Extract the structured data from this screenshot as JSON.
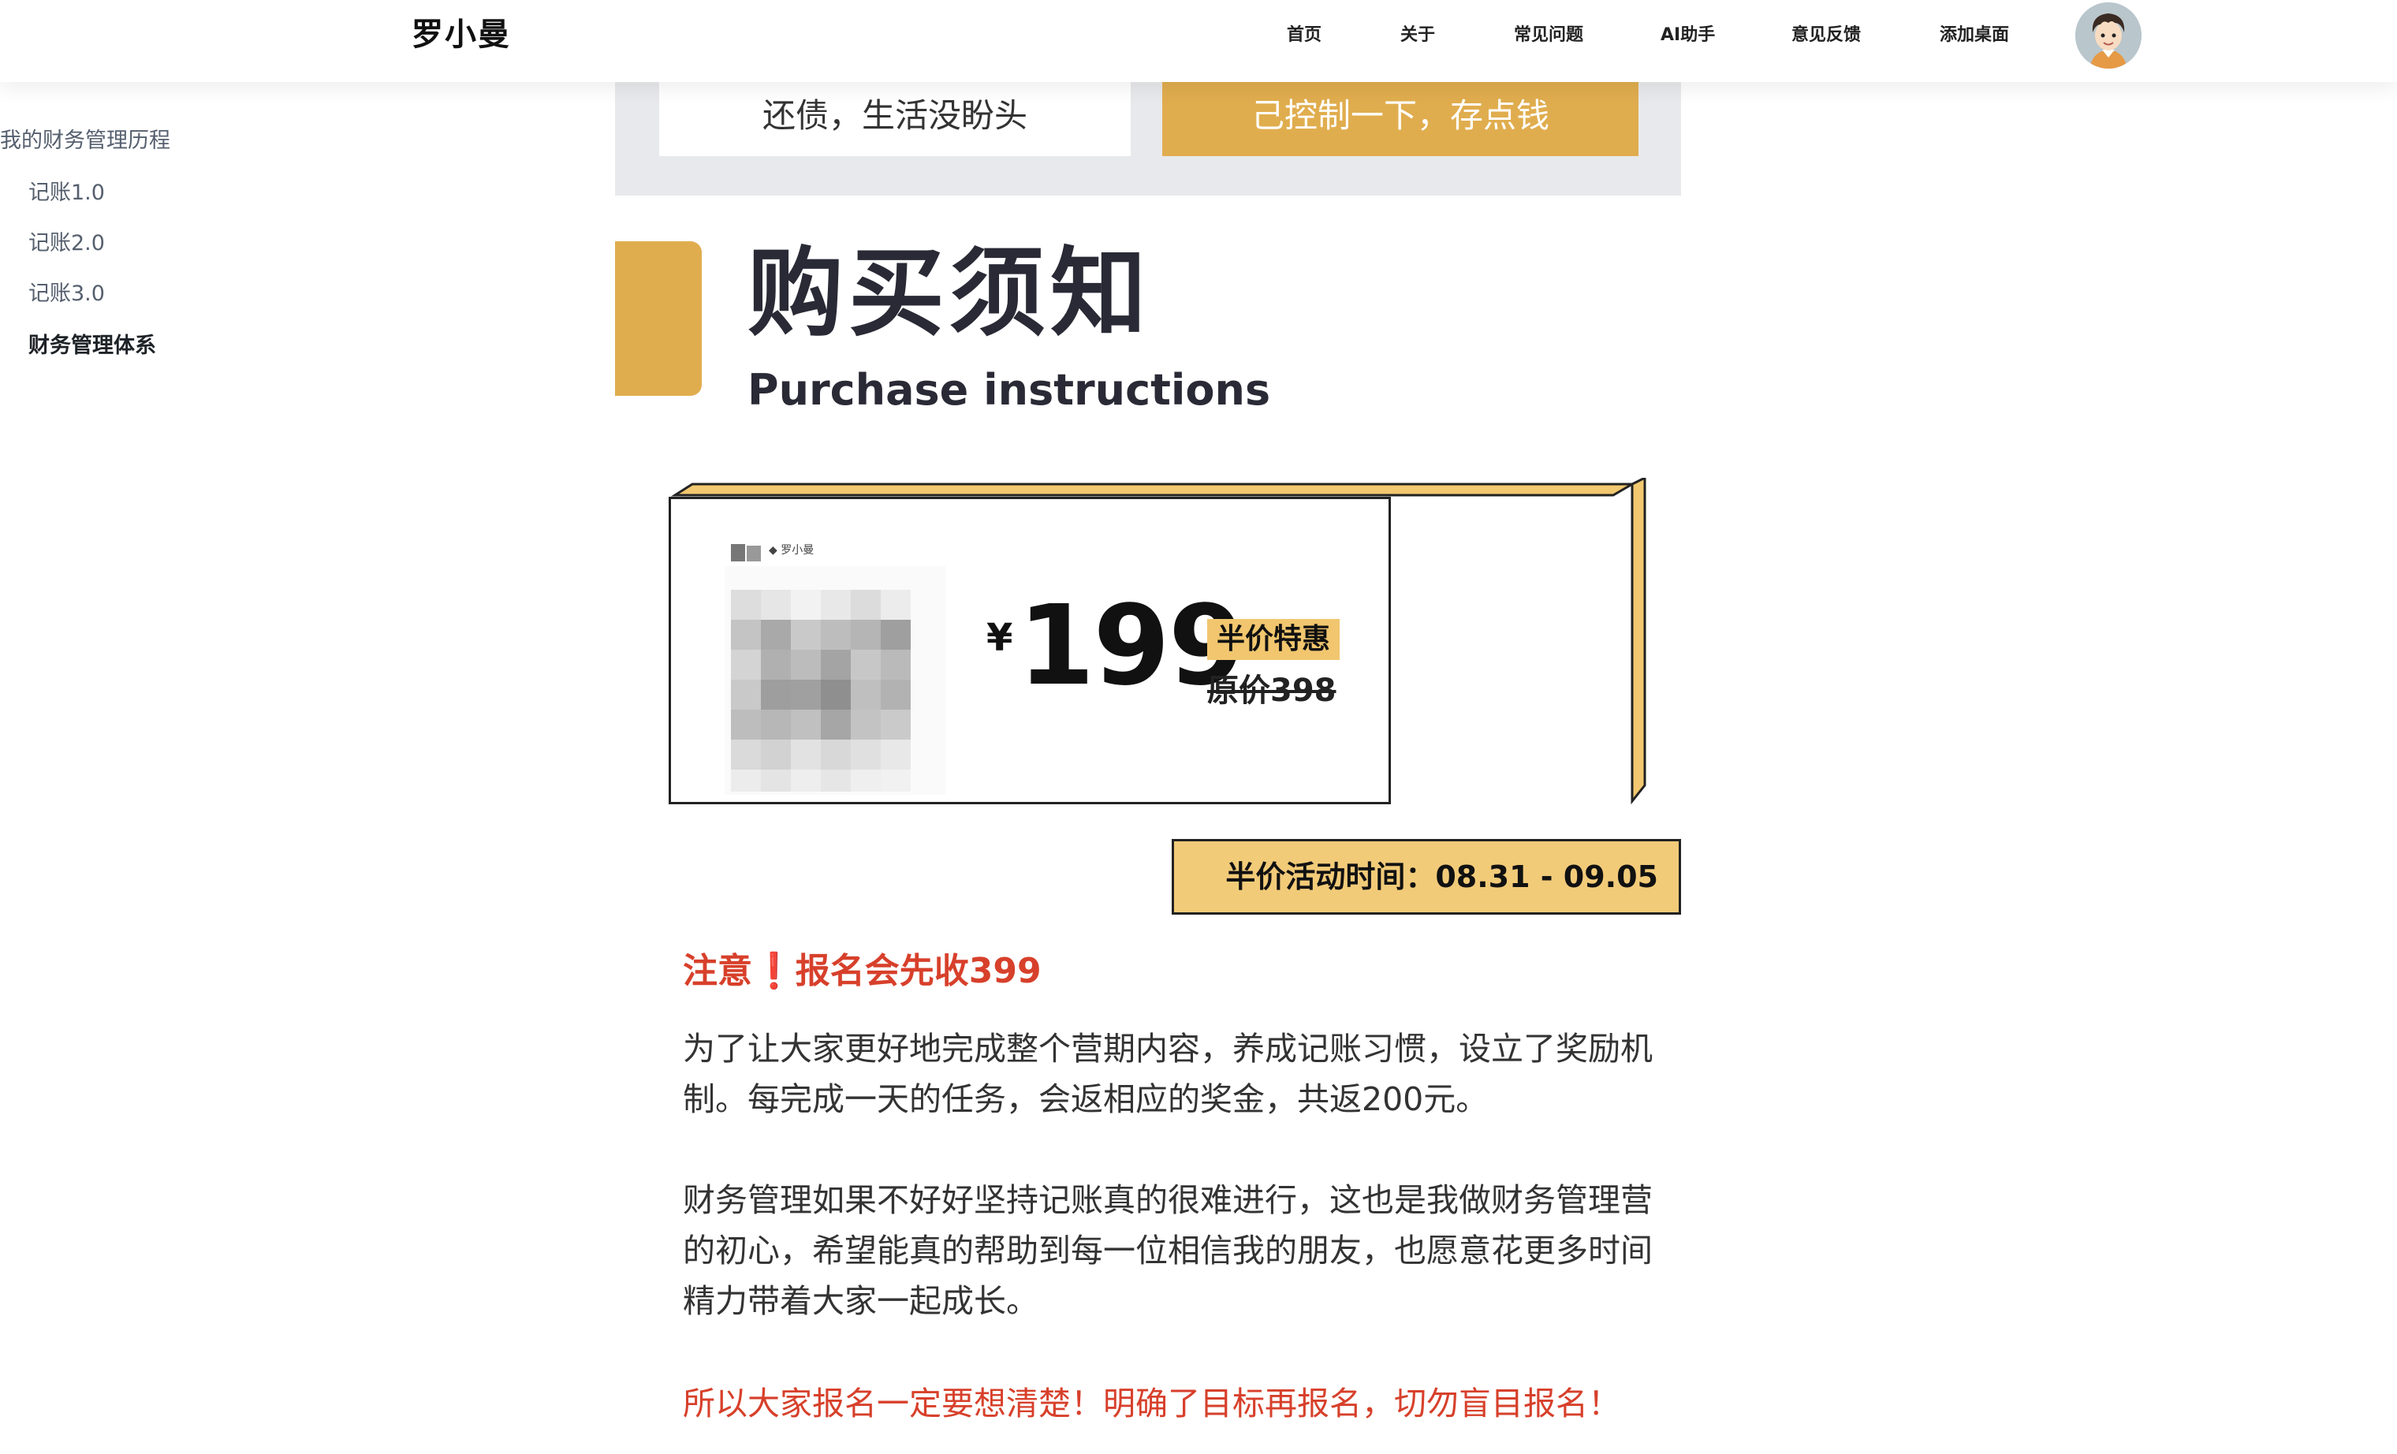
{
  "header": {
    "site_title": "罗小曼",
    "nav": [
      {
        "label": "首页"
      },
      {
        "label": "关于"
      },
      {
        "label": "常见问题"
      },
      {
        "label": "AI助手"
      },
      {
        "label": "意见反馈"
      },
      {
        "label": "添加桌面"
      }
    ]
  },
  "sidebar": {
    "title": "我的财务管理历程",
    "items": [
      {
        "label": "记账1.0"
      },
      {
        "label": "记账2.0"
      },
      {
        "label": "记账3.0"
      },
      {
        "label": "财务管理体系"
      }
    ],
    "active_index": 3
  },
  "banner": {
    "left_option": "还债，生活没盼头",
    "right_option": "己控制一下，存点钱"
  },
  "section": {
    "title_cn": "购买须知",
    "title_en": "Purchase instructions"
  },
  "price_card": {
    "qr_label": "◆ 罗小曼",
    "currency": "¥",
    "price": "199",
    "discount_badge": "半价特惠",
    "original_price": "原价398"
  },
  "event_time": "半价活动时间：08.31 - 09.05",
  "notice": {
    "title": "注意❗报名会先收399",
    "para1": "为了让大家更好地完成整个营期内容，养成记账习惯，设立了奖励机制。每完成一天的任务，会返相应的奖金，共返200元。",
    "para2": "财务管理如果不好好坚持记账真的很难进行，这也是我做财务管理营的初心，希望能真的帮助到每一位相信我的朋友，也愿意花更多时间精力带着大家一起成长。",
    "para3": "所以大家报名一定要想清楚！明确了目标再报名，切勿盲目报名！"
  },
  "colors": {
    "accent_gold": "#e0ad4e",
    "badge_gold": "#f1c66e",
    "notice_red": "#d7402b",
    "title_dark": "#2a2a36"
  }
}
